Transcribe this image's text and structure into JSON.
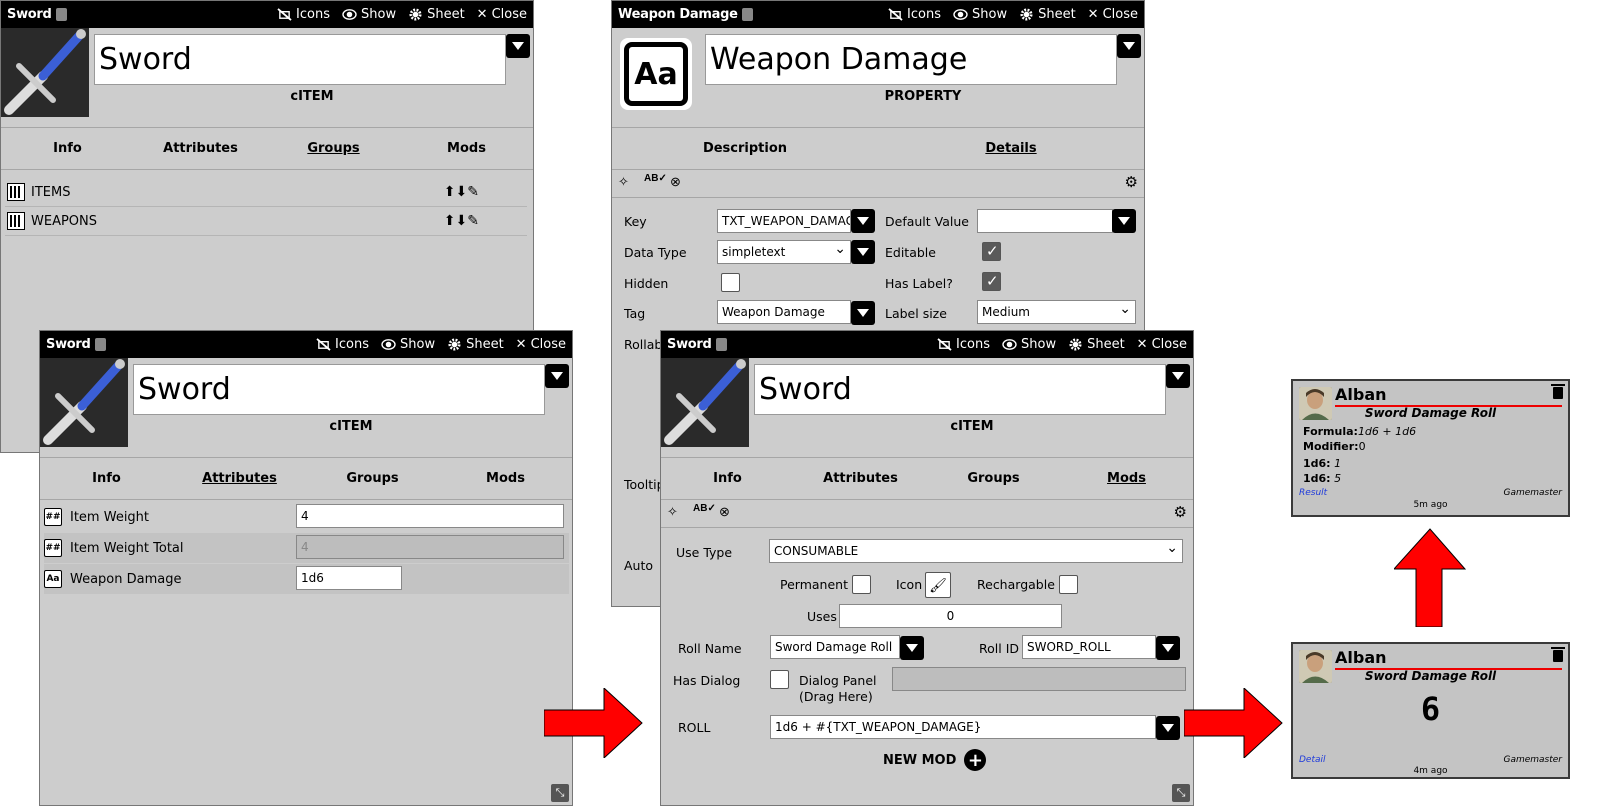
{
  "colors": {
    "titlebar": "#000000",
    "panel": "#cdcdcd",
    "arrow": "#ff0000",
    "chat_underline": "#e00000"
  },
  "common": {
    "icons": "Icons",
    "show": "Show",
    "sheet": "Sheet",
    "close": "Close"
  },
  "win1": {
    "title": "Sword",
    "name": "Sword",
    "subtitle": "cITEM",
    "tabs": [
      "Info",
      "Attributes",
      "Groups",
      "Mods"
    ],
    "active_tab": "Groups",
    "groups": [
      "ITEMS",
      "WEAPONS"
    ]
  },
  "win2": {
    "title": "Weapon Damage",
    "name": "Weapon Damage",
    "subtitle": "PROPERTY",
    "logo": "Aa",
    "tabs": [
      "Description",
      "Details"
    ],
    "active_tab": "Details",
    "key_label": "Key",
    "key_value": "TXT_WEAPON_DAMAGE",
    "datatype_label": "Data Type",
    "datatype_value": "simpletext",
    "hidden_label": "Hidden",
    "tag_label": "Tag",
    "tag_value": "Weapon Damage",
    "rollable_label": "Rollab",
    "tooltip_label": "Tooltip",
    "auto_label": "Auto",
    "default_label": "Default Value",
    "default_value": "",
    "editable_label": "Editable",
    "editable": true,
    "haslabel_label": "Has Label?",
    "haslabel": true,
    "labelsize_label": "Label size",
    "labelsize_value": "Medium"
  },
  "win3": {
    "title": "Sword",
    "name": "Sword",
    "subtitle": "cITEM",
    "tabs": [
      "Info",
      "Attributes",
      "Groups",
      "Mods"
    ],
    "active_tab": "Attributes",
    "attrs": [
      {
        "icon": "##",
        "label": "Item Weight",
        "value": "4",
        "disabled": false
      },
      {
        "icon": "##",
        "label": "Item Weight Total",
        "value": "4",
        "disabled": true
      },
      {
        "icon": "Aa",
        "label": "Weapon Damage",
        "value": "1d6",
        "disabled": false
      }
    ]
  },
  "win4": {
    "title": "Sword",
    "name": "Sword",
    "subtitle": "cITEM",
    "tabs": [
      "Info",
      "Attributes",
      "Groups",
      "Mods"
    ],
    "active_tab": "Mods",
    "usetype_label": "Use Type",
    "usetype_value": "CONSUMABLE",
    "permanent_label": "Permanent",
    "icon_label": "Icon",
    "rechargable_label": "Rechargable",
    "uses_label": "Uses",
    "uses_value": "0",
    "rollname_label": "Roll Name",
    "rollname_value": "Sword Damage Roll",
    "rollid_label": "Roll ID",
    "rollid_value": "SWORD_ROLL",
    "hasdialog_label": "Has Dialog",
    "dialogpanel_label1": "Dialog Panel",
    "dialogpanel_label2": "(Drag Here)",
    "roll_label": "ROLL",
    "roll_value": "1d6 + #{TXT_WEAPON_DAMAGE}",
    "newmod_label": "NEW MOD"
  },
  "chat1": {
    "name": "Alban",
    "roll_title": "Sword Damage Roll",
    "formula_label": "Formula:",
    "formula_value": "1d6 + 1d6",
    "modifier_label": "Modifier:",
    "modifier_value": "0",
    "d1_label": "1d6:",
    "d1_value": "1",
    "d2_label": "1d6:",
    "d2_value": "5",
    "link": "Result",
    "gm": "Gamemaster",
    "time": "5m ago"
  },
  "chat2": {
    "name": "Alban",
    "roll_title": "Sword Damage Roll",
    "total": "6",
    "link": "Detail",
    "gm": "Gamemaster",
    "time": "4m ago"
  }
}
